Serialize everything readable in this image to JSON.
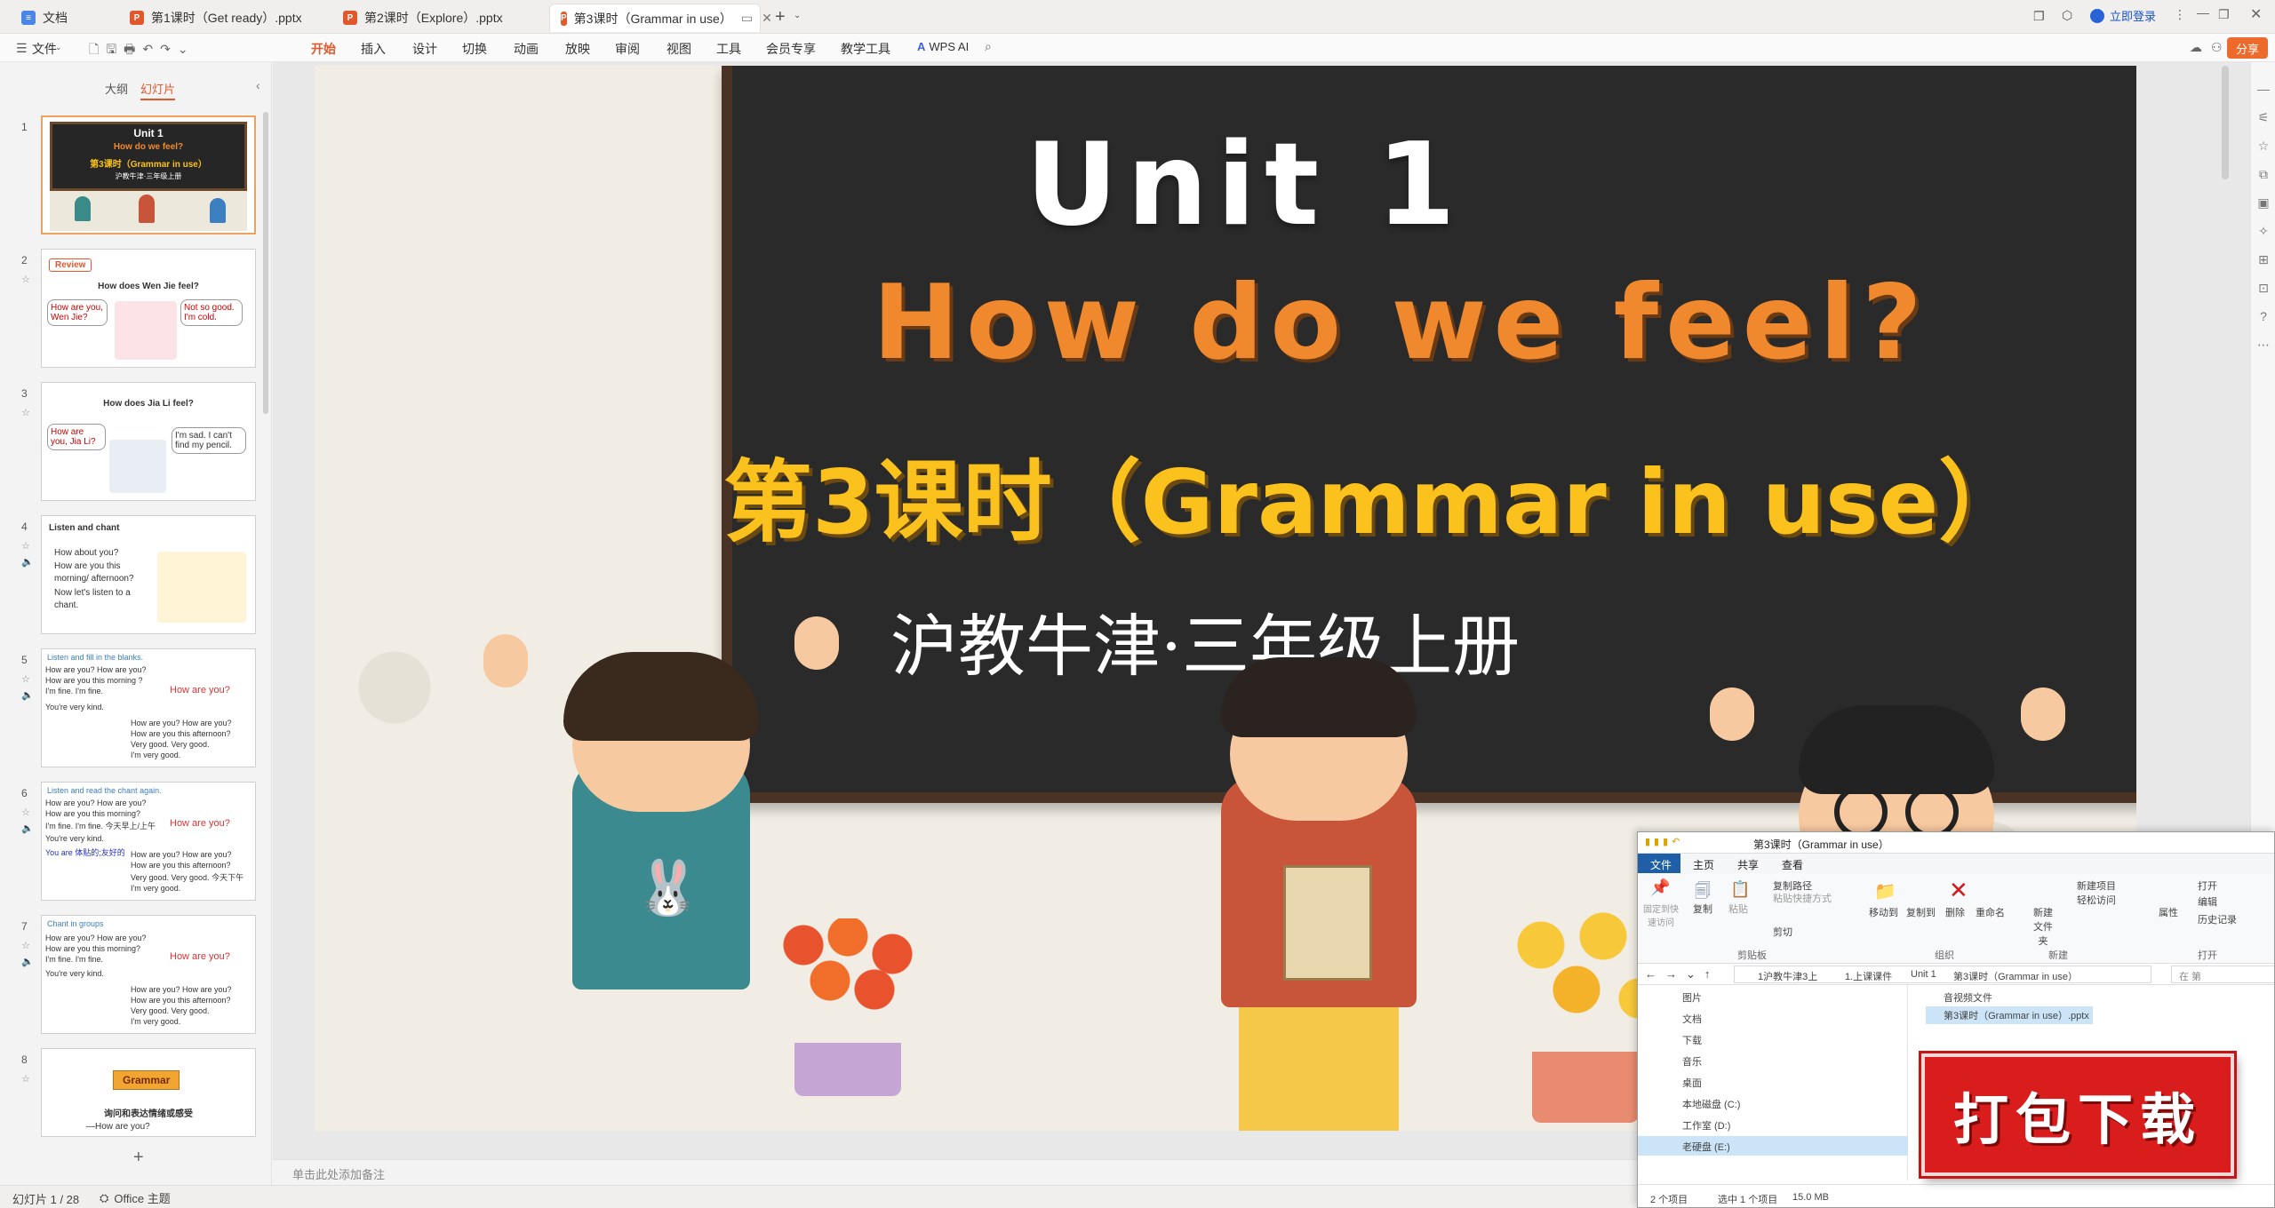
{
  "tabs": [
    {
      "label": "文档",
      "icon": "doc-icon"
    },
    {
      "label": "第1课时（Get ready）.pptx",
      "icon": "ppt-icon"
    },
    {
      "label": "第2课时（Explore）.pptx",
      "icon": "ppt-icon"
    },
    {
      "label": "第3课时（Grammar in use）",
      "icon": "ppt-icon"
    }
  ],
  "titlebar": {
    "login": "立即登录",
    "share": "分享"
  },
  "ribbon": {
    "file": "文件",
    "items": [
      "开始",
      "插入",
      "设计",
      "切换",
      "动画",
      "放映",
      "审阅",
      "视图",
      "工具",
      "会员专享",
      "教学工具"
    ],
    "ai": "WPS AI",
    "active": "开始"
  },
  "panel": {
    "outline_tab": "大纲",
    "slides_tab": "幻灯片"
  },
  "thumbs": [
    {
      "num": "1",
      "lines": [
        "Unit 1",
        "How do we feel?",
        "第3课时（Grammar in use）",
        "沪教牛津·三年级上册"
      ]
    },
    {
      "num": "2",
      "lines": [
        "Review",
        "How does Wen Jie feel?",
        "How are you, Wen Jie?",
        "Not so good. I'm cold."
      ]
    },
    {
      "num": "3",
      "lines": [
        "How does Jia Li feel?",
        "How are you, Jia Li?",
        "I'm sad. I can't find my pencil."
      ]
    },
    {
      "num": "4",
      "lines": [
        "Listen and chant",
        "How about you?",
        "How are you this morning/ afternoon?",
        "Now let's listen to a chant."
      ]
    },
    {
      "num": "5",
      "lines": [
        "Listen and fill in the blanks.",
        "How are you? How are you?",
        "How are you this morning ?",
        "I'm fine. I'm fine.",
        "How are you?",
        "You're very kind.",
        "How are you? How are you?",
        "How are you this afternoon?",
        "Very good. Very good.",
        "I'm very good."
      ]
    },
    {
      "num": "6",
      "lines": [
        "Listen and read the chant again.",
        "How are you? How are you?",
        "How are you this morning?",
        "I'm fine. I'm fine. 今天早上/上午",
        "How are you?",
        "You're very kind.",
        "You are 体贴的;友好的",
        "How are you? How are you?",
        "How are you this afternoon?",
        "Very good. Very good. 今天下午",
        "I'm very good."
      ]
    },
    {
      "num": "7",
      "lines": [
        "Chant in groups",
        "How are you? How are you?",
        "How are you this morning?",
        "I'm fine. I'm fine.",
        "How are you?",
        "You're very kind.",
        "How are you? How are you?",
        "How are you this afternoon?",
        "Very good. Very good.",
        "I'm very good."
      ]
    },
    {
      "num": "8",
      "lines": [
        "Grammar",
        "询问和表达情绪或感受",
        "—How are you?"
      ]
    }
  ],
  "slide": {
    "title": "Unit 1",
    "subtitle": "How do we feel?",
    "lesson": "第3课时（Grammar in use）",
    "publisher": "沪教牛津·三年级上册"
  },
  "notes_placeholder": "单击此处添加备注",
  "status": {
    "slide_info": "幻灯片 1 / 28",
    "theme": "Office 主题"
  },
  "explorer": {
    "title": "第3课时（Grammar in use）",
    "tabs": [
      "文件",
      "主页",
      "共享",
      "查看"
    ],
    "ribbon": {
      "pin": "固定到快速访问",
      "copy": "复制",
      "paste": "粘贴",
      "copy_path": "复制路径",
      "paste_shortcut": "粘贴快捷方式",
      "cut": "剪切",
      "clipboard": "剪贴板",
      "move_to": "移动到",
      "copy_to": "复制到",
      "delete": "删除",
      "rename": "重命名",
      "organize": "组织",
      "new_folder": "新建文件夹",
      "new_item": "新建项目",
      "easy_access": "轻松访问",
      "new": "新建",
      "properties": "属性",
      "open": "打开",
      "edit": "编辑",
      "history": "历史记录",
      "open_group": "打开"
    },
    "path": [
      "1沪教牛津3上",
      "1.上课课件",
      "Unit 1",
      "第3课时（Grammar in use）"
    ],
    "search": "在 第",
    "nav": [
      "图片",
      "文档",
      "下载",
      "音乐",
      "桌面",
      "本地磁盘 (C:)",
      "工作室 (D:)",
      "老硬盘 (E:)"
    ],
    "files": [
      "音视频文件",
      "第3课时（Grammar in use）.pptx"
    ],
    "status": {
      "count": "2 个项目",
      "selected": "选中 1 个项目",
      "size": "15.0 MB"
    }
  },
  "download_banner": "打包下载"
}
